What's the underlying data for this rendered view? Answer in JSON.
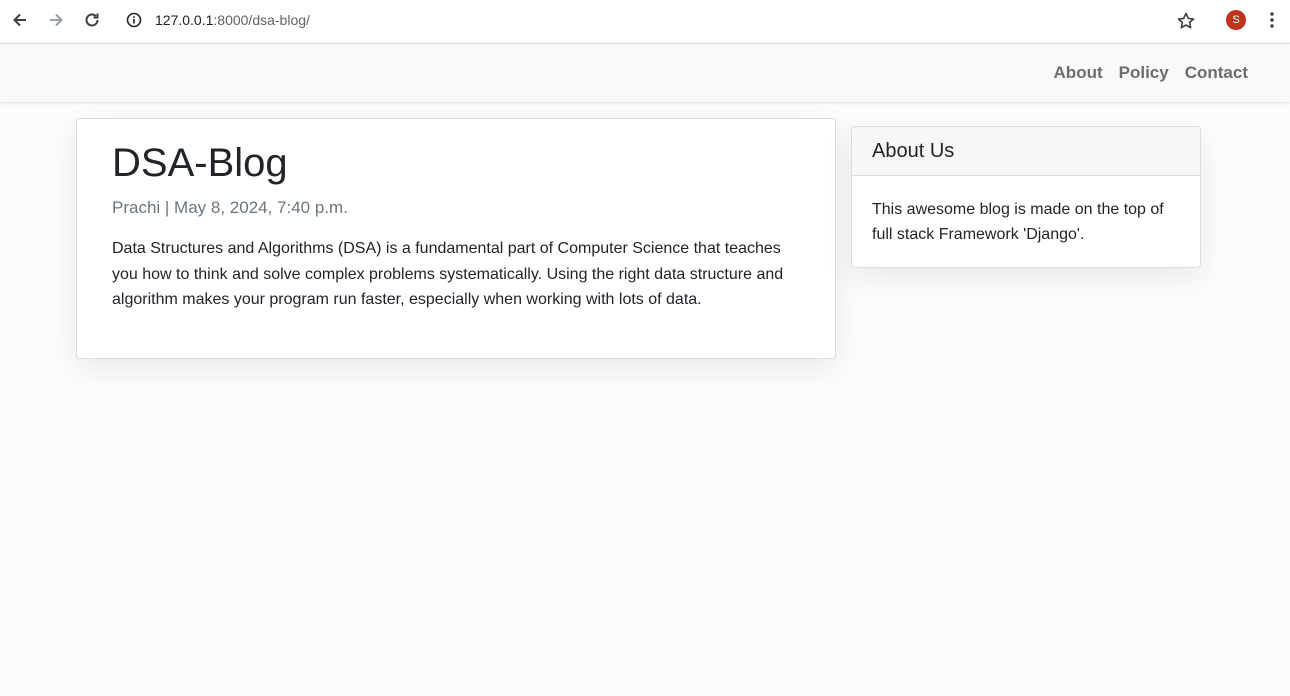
{
  "browser": {
    "url_host": "127.0.0.1",
    "url_rest": ":8000/dsa-blog/",
    "avatar_letter": "S",
    "avatar_color": "#c0341d"
  },
  "nav": {
    "links": [
      {
        "label": "About"
      },
      {
        "label": "Policy"
      },
      {
        "label": "Contact"
      }
    ]
  },
  "post": {
    "title": "DSA-Blog",
    "meta": "Prachi | May 8, 2024, 7:40 p.m.",
    "body": "Data Structures and Algorithms (DSA) is a fundamental part of Computer Science that teaches you how to think and solve complex problems systematically. Using the right data structure and algorithm makes your program run faster, especially when working with lots of data."
  },
  "sidebar": {
    "title": "About Us",
    "text": "This awesome blog is made on the top of full stack Framework 'Django'."
  }
}
